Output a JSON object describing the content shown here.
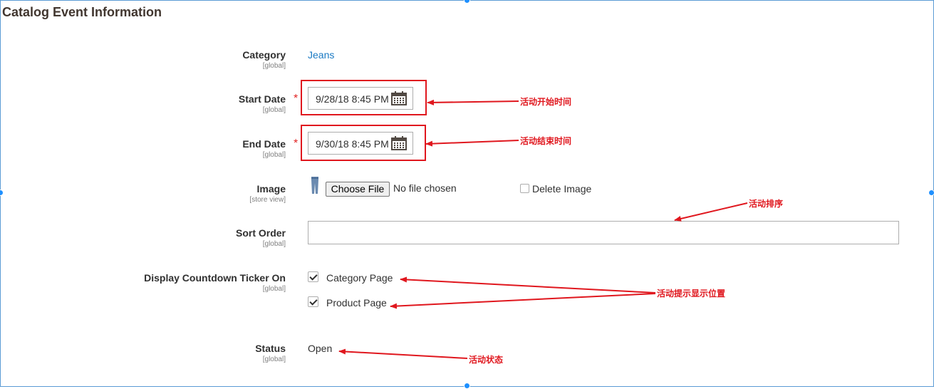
{
  "section": {
    "title": "Catalog Event Information"
  },
  "fields": {
    "category": {
      "label": "Category",
      "scope": "[global]",
      "value": "Jeans"
    },
    "start_date": {
      "label": "Start Date",
      "scope": "[global]",
      "required": "*",
      "value": "9/28/18 8:45 PM"
    },
    "end_date": {
      "label": "End Date",
      "scope": "[global]",
      "required": "*",
      "value": "9/30/18 8:45 PM"
    },
    "image": {
      "label": "Image",
      "scope": "[store view]",
      "choose_button": "Choose File",
      "file_status": "No file chosen",
      "delete_label": "Delete Image",
      "delete_checked": false
    },
    "sort_order": {
      "label": "Sort Order",
      "scope": "[global]",
      "value": ""
    },
    "countdown": {
      "label": "Display Countdown Ticker On",
      "scope": "[global]",
      "options": [
        {
          "label": "Category Page",
          "checked": true
        },
        {
          "label": "Product Page",
          "checked": true
        }
      ]
    },
    "status": {
      "label": "Status",
      "scope": "[global]",
      "value": "Open"
    }
  },
  "annotations": {
    "start_time": "活动开始时间",
    "end_time": "活动结束时间",
    "sort": "活动排序",
    "display_position": "活动提示显示位置",
    "status": "活动状态"
  },
  "icons": {
    "calendar": "calendar-icon",
    "image_thumbnail": "jeans-thumbnail-icon"
  },
  "colors": {
    "annotation": "#e0171e",
    "link": "#1979c3",
    "required": "#e22626",
    "frame_border": "#5b9bd5"
  }
}
